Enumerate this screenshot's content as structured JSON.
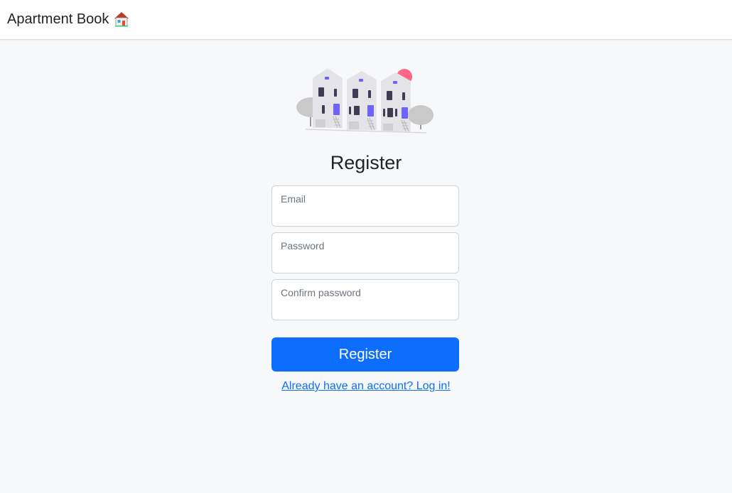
{
  "navbar": {
    "brand": "Apartment Book",
    "brand_icon": "house-icon"
  },
  "hero": {
    "illustration": "apartment-buildings-illustration",
    "colors": {
      "building": "#e4e4e8",
      "window_dark": "#3f3d56",
      "window_accent": "#6c63ff",
      "sun": "#ff6584",
      "tree": "#c9c9c9"
    }
  },
  "form": {
    "title": "Register",
    "email": {
      "label": "Email",
      "value": ""
    },
    "password": {
      "label": "Password",
      "value": ""
    },
    "confirm_password": {
      "label": "Confirm password",
      "value": ""
    },
    "submit_label": "Register",
    "login_link": "Already have an account? Log in!"
  },
  "colors": {
    "primary": "#0d6efd",
    "background": "#f7f8fa"
  }
}
